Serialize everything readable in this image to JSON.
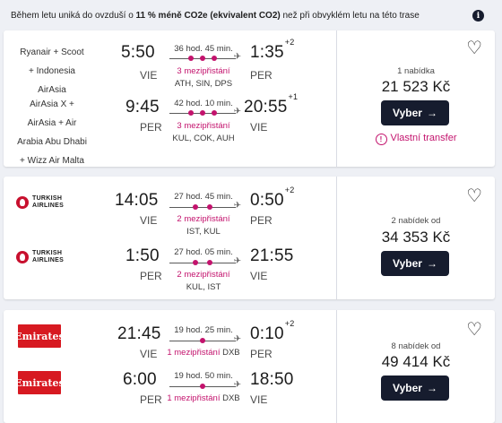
{
  "banner": {
    "prefix": "Během letu uniká do ovzduší o ",
    "highlight": "11 % méně CO2e (ekvivalent CO2)",
    "suffix": " než při obvyklém letu na této trase",
    "info_icon": "info-icon"
  },
  "cards": [
    {
      "legs": [
        {
          "airline": [
            "Ryanair + Scoot",
            "+ Indonesia",
            "AirAsia"
          ],
          "dep_time": "5:50",
          "dep_code": "VIE",
          "duration": "36 hod. 45 min.",
          "stops_label": "3 mezipřistání",
          "stops_count": 3,
          "via": "ATH, SIN, DPS",
          "arr_time": "1:35",
          "arr_offset": "+2",
          "arr_code": "PER"
        },
        {
          "airline": [
            "AirAsia X +",
            "AirAsia + Air",
            "Arabia Abu Dhabi",
            "+ Wizz Air Malta"
          ],
          "dep_time": "9:45",
          "dep_code": "PER",
          "duration": "42 hod. 10 min.",
          "stops_label": "3 mezipřistání",
          "stops_count": 3,
          "via": "KUL, COK, AUH",
          "arr_time": "20:55",
          "arr_offset": "+1",
          "arr_code": "VIE"
        }
      ],
      "offers": "1 nabídka",
      "price": "21 523 Kč",
      "button": "Vyber",
      "transfer": "Vlastní transfer"
    },
    {
      "logo": "TURKISH AIRLINES",
      "legs": [
        {
          "logo_top": "TURKISH",
          "logo_bottom": "AIRLINES",
          "dep_time": "14:05",
          "dep_code": "VIE",
          "duration": "27 hod. 45 min.",
          "stops_label": "2 mezipřistání",
          "stops_count": 2,
          "via": "IST, KUL",
          "arr_time": "0:50",
          "arr_offset": "+2",
          "arr_code": "PER"
        },
        {
          "logo_top": "TURKISH",
          "logo_bottom": "AIRLINES",
          "dep_time": "1:50",
          "dep_code": "PER",
          "duration": "27 hod. 05 min.",
          "stops_label": "2 mezipřistání",
          "stops_count": 2,
          "via": "KUL, IST",
          "arr_time": "21:55",
          "arr_offset": "",
          "arr_code": "VIE"
        }
      ],
      "offers": "2 nabídek od",
      "price": "34 353 Kč",
      "button": "Vyber"
    },
    {
      "legs": [
        {
          "logo": "Emirates",
          "dep_time": "21:45",
          "dep_code": "VIE",
          "duration": "19 hod. 25 min.",
          "stops_label": "1 mezipřistání",
          "stops_count": 1,
          "via": "DXB",
          "arr_time": "0:10",
          "arr_offset": "+2",
          "arr_code": "PER"
        },
        {
          "logo": "Emirates",
          "dep_time": "6:00",
          "dep_code": "PER",
          "duration": "19 hod. 50 min.",
          "stops_label": "1 mezipřistání",
          "stops_count": 1,
          "via": "DXB",
          "arr_time": "18:50",
          "arr_offset": "",
          "arr_code": "VIE"
        }
      ],
      "offers": "8 nabídek od",
      "price": "49 414 Kč",
      "button": "Vyber"
    }
  ],
  "colors": {
    "accent": "#c3136d",
    "button": "#161c2e",
    "turkish": "#c8102e",
    "emirates": "#d71921"
  }
}
